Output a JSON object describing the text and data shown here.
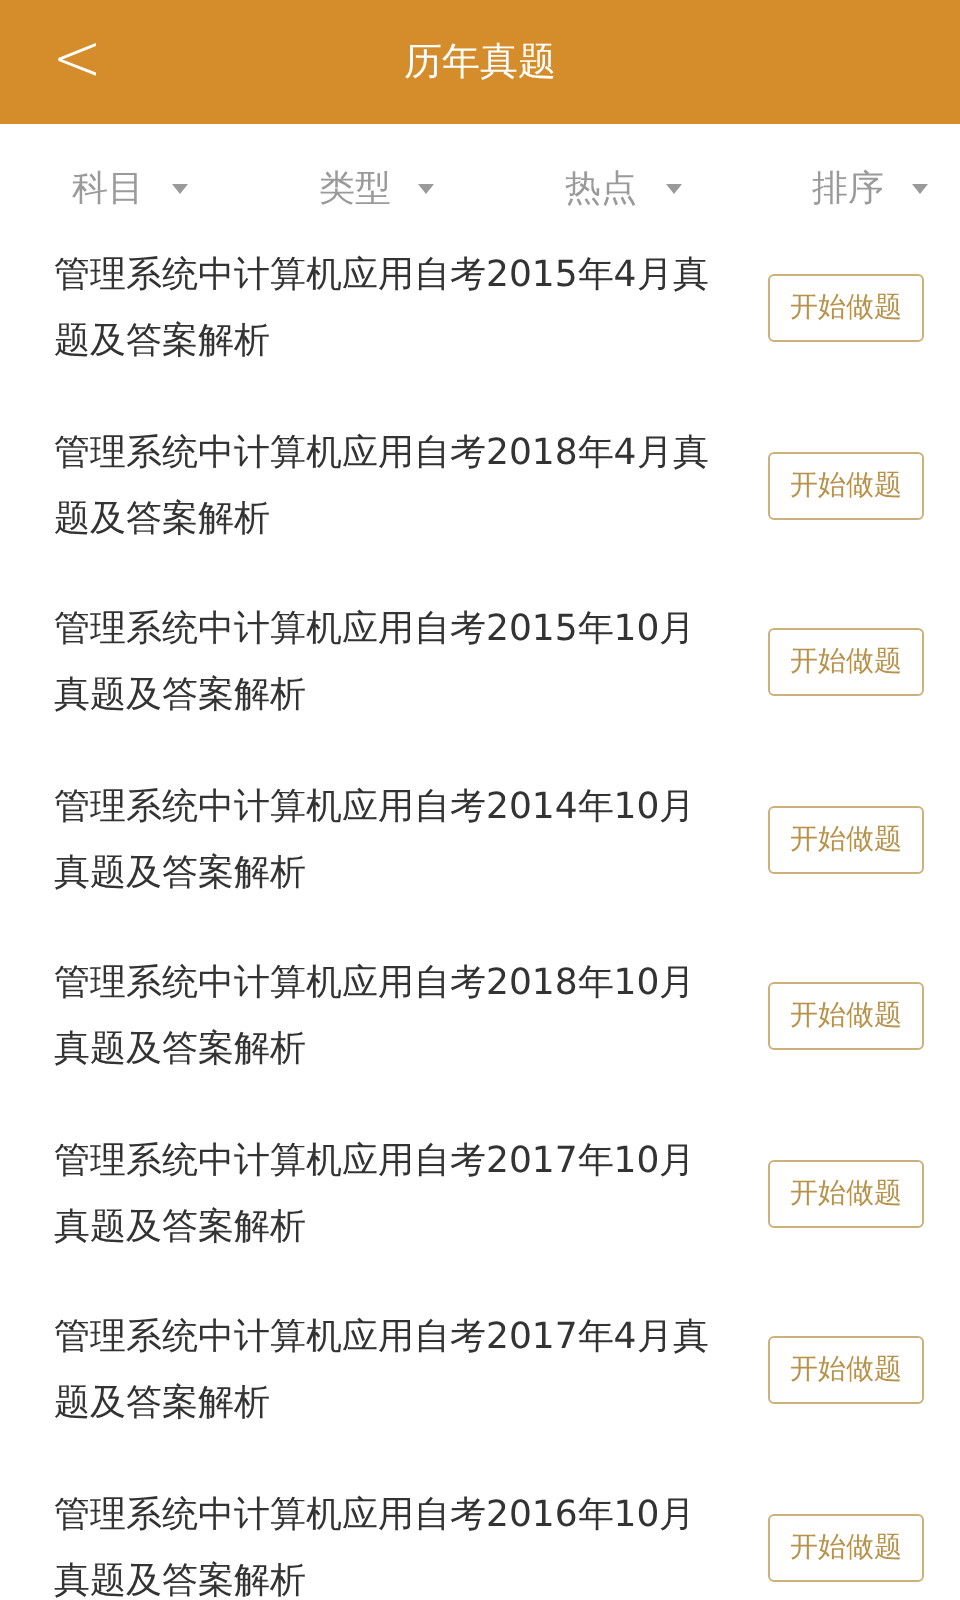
{
  "header": {
    "back": "<",
    "title": "历年真题"
  },
  "filters": [
    {
      "label": "科目"
    },
    {
      "label": "类型"
    },
    {
      "label": "热点"
    },
    {
      "label": "排序"
    }
  ],
  "papers": [
    {
      "title": "管理系统中计算机应用自考2015年4月真题及答案解析",
      "action": "开始做题"
    },
    {
      "title": "管理系统中计算机应用自考2018年4月真题及答案解析",
      "action": "开始做题"
    },
    {
      "title": "管理系统中计算机应用自考2015年10月真题及答案解析",
      "action": "开始做题"
    },
    {
      "title": "管理系统中计算机应用自考2014年10月真题及答案解析",
      "action": "开始做题"
    },
    {
      "title": "管理系统中计算机应用自考2018年10月真题及答案解析",
      "action": "开始做题"
    },
    {
      "title": "管理系统中计算机应用自考2017年10月真题及答案解析",
      "action": "开始做题"
    },
    {
      "title": "管理系统中计算机应用自考2017年4月真题及答案解析",
      "action": "开始做题"
    },
    {
      "title": "管理系统中计算机应用自考2016年10月真题及答案解析",
      "action": "开始做题"
    }
  ]
}
